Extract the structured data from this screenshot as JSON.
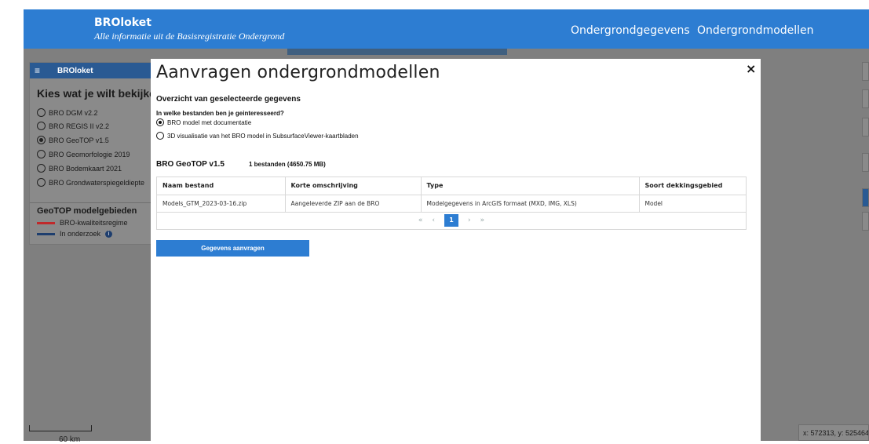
{
  "header": {
    "brand_title": "BROloket",
    "brand_subtitle": "Alle informatie uit de Basisregistratie Ondergrond",
    "nav": [
      "Ondergrondgegevens",
      "Ondergrondmodellen"
    ]
  },
  "left_panel": {
    "title": "BROloket",
    "menu_icon": "hamburger-icon",
    "prompt": "Kies wat je wilt bekijken",
    "options": [
      {
        "label": "BRO DGM v2.2",
        "selected": false
      },
      {
        "label": "BRO REGIS II v2.2",
        "selected": false
      },
      {
        "label": "BRO GeoTOP v1.5",
        "selected": true
      },
      {
        "label": "BRO Geomorfologie 2019",
        "selected": false
      },
      {
        "label": "BRO Bodemkaart 2021",
        "selected": false
      },
      {
        "label": "BRO Grondwaterspiegeldiepte",
        "selected": false
      }
    ],
    "legend_title": "GeoTOP modelgebieden",
    "legend": [
      {
        "label": "BRO-kwaliteitsregime",
        "color": "#c0292b"
      },
      {
        "label": "In onderzoek",
        "color": "#1e3e6e"
      }
    ]
  },
  "map": {
    "scale_label": "60 km",
    "coords": "x: 572313, y: 525464"
  },
  "modal": {
    "title": "Aanvragen ondergrondmodellen",
    "close_label": "×",
    "subtitle": "Overzicht van geselecteerde gegevens",
    "question": "In welke bestanden ben je geinteresseerd?",
    "choices": [
      {
        "label": "BRO model met documentatie",
        "selected": true
      },
      {
        "label": "3D visualisatie van het BRO model in SubsurfaceViewer-kaartbladen",
        "selected": false
      }
    ],
    "dataset": {
      "name": "BRO GeoTOP v1.5",
      "count": "1 bestanden (4650.75 MB)"
    },
    "table": {
      "headers": [
        "Naam bestand",
        "Korte omschrijving",
        "Type",
        "Soort dekkingsgebied"
      ],
      "rows": [
        [
          "Models_GTM_2023-03-16.zip",
          "Aangeleverde ZIP aan de BRO",
          "Modelgegevens in ArcGIS formaat (MXD, IMG, XLS)",
          "Model"
        ]
      ]
    },
    "pager": {
      "first": "«",
      "prev": "‹",
      "current": "1",
      "next": "›",
      "last": "»"
    },
    "request_button": "Gegevens aanvragen"
  },
  "colors": {
    "brand": "#2d7dd2",
    "overlay": "#7f7f7f",
    "panel_header": "#2a5a93"
  }
}
